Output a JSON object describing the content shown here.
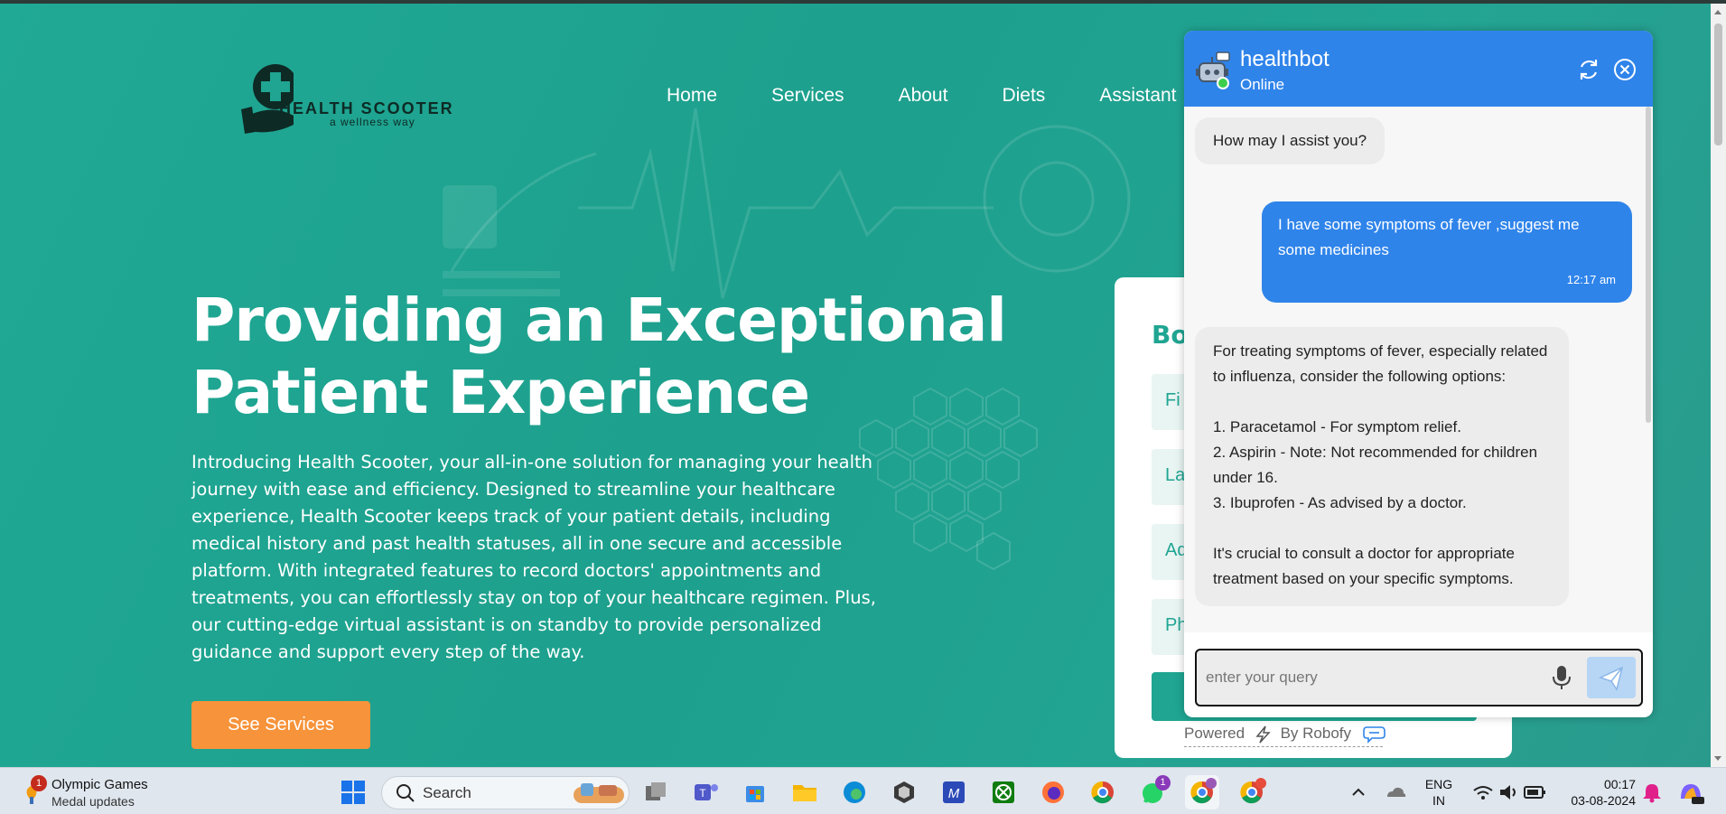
{
  "site": {
    "logo": {
      "brand": "HEALTH SCOOTER",
      "tagline": "a wellness way"
    },
    "nav": [
      "Home",
      "Services",
      "About",
      "Diets",
      "Assistant"
    ],
    "hero": {
      "title": "Providing an Exceptional Patient Experience",
      "text": "Introducing Health Scooter, your all-in-one solution for managing your health journey with ease and efficiency. Designed to streamline your healthcare experience, Health Scooter keeps track of your patient details, including medical history and past health statuses, all in one secure and accessible platform. With integrated features to record doctors' appointments and treatments, you can effortlessly stay on top of your healthcare regimen. Plus, our cutting-edge virtual assistant is on standby to provide personalized guidance and support every step of the way.",
      "button": "See Services"
    },
    "form": {
      "title_partial": "Bo",
      "fields": [
        "Fi",
        "La",
        "Ad",
        "Ph"
      ]
    }
  },
  "chatbot": {
    "name": "healthbot",
    "status": "Online",
    "messages": [
      {
        "from": "bot",
        "text": "How may I assist you?"
      },
      {
        "from": "user",
        "text": "I have some symptoms of fever ,suggest me some medicines",
        "time": "12:17 am"
      },
      {
        "from": "bot",
        "intro": "For treating symptoms of fever, especially related to influenza, consider the following options:",
        "items": [
          {
            "num": "1. Paracetamol",
            "note": "For symptom relief."
          },
          {
            "num": "2. Aspirin",
            "note": "Note: Not recommended for children under 16."
          },
          {
            "num": "3. Ibuprofen",
            "note": "As advised by a doctor."
          }
        ],
        "outro": "It's crucial to consult a doctor for appropriate treatment based on your specific symptoms."
      }
    ],
    "input_placeholder": "enter your query",
    "powered": {
      "prefix": "Powered",
      "suffix": "By Robofy"
    }
  },
  "taskbar": {
    "news": {
      "title": "Olympic Games",
      "subtitle": "Medal updates",
      "badge": "1"
    },
    "search_label": "Search",
    "whatsapp_badge": "1",
    "lang": {
      "line1": "ENG",
      "line2": "IN"
    },
    "clock": {
      "time": "00:17",
      "date": "03-08-2024"
    }
  },
  "colors": {
    "teal": "#1fa592",
    "chat_blue": "#2f84ea",
    "orange": "#f7933a"
  }
}
